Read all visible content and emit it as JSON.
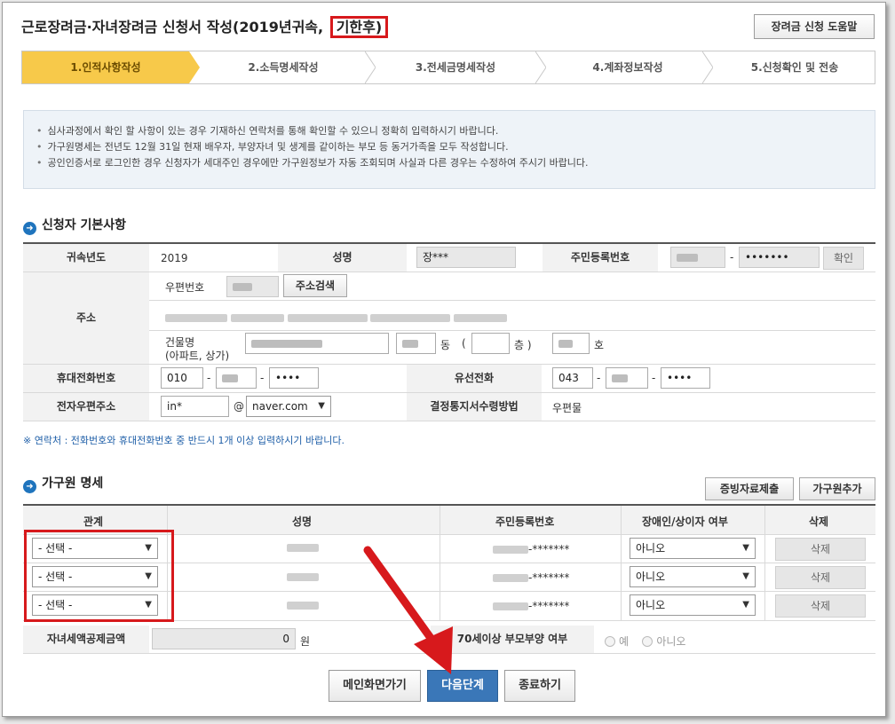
{
  "page": {
    "title_main": "근로장려금·자녀장려금 신청서 작성(2019년귀속,",
    "title_highlight": "기한후)",
    "help_label": "장려금 신청 도움말"
  },
  "steps": [
    {
      "label": "1.인적사항작성",
      "active": true
    },
    {
      "label": "2.소득명세작성",
      "active": false
    },
    {
      "label": "3.전세금명세작성",
      "active": false
    },
    {
      "label": "4.계좌정보작성",
      "active": false
    },
    {
      "label": "5.신청확인 및 전송",
      "active": false
    }
  ],
  "notice": [
    "심사과정에서 확인 할 사항이 있는 경우 기재하신 연락처를 통해 확인할 수 있으니 정확히 입력하시기 바랍니다.",
    "가구원명세는 전년도 12월 31일 현재 배우자, 부양자녀 및 생계를 같이하는 부모 등 동거가족을 모두 작성합니다.",
    "공인인증서로 로그인한 경우 신청자가 세대주인 경우에만 가구원정보가 자동 조회되며 사실과 다른 경우는 수정하여 주시기 바랍니다."
  ],
  "applicant": {
    "section_title": "신청자 기본사항",
    "year_label": "귀속년도",
    "year_value": "2019",
    "name_label": "성명",
    "name_value": "장***",
    "rrn_label": "주민등록번호",
    "rrn_back": "•••••••",
    "confirm_label": "확인",
    "address_label": "주소",
    "postcode_label": "우편번호",
    "address_search_label": "주소검색",
    "building_label": "건물명",
    "building_sub": "(아파트, 상가)",
    "dong_label": "동",
    "floor_open": "(",
    "floor_label": "층 )",
    "ho_label": "호",
    "mobile_label": "휴대전화번호",
    "mobile_1": "010",
    "mobile_3": "••••",
    "landline_label": "유선전화",
    "landline_1": "043",
    "landline_3": "••••",
    "dash": "-",
    "email_label": "전자우편주소",
    "email_id": "in*",
    "email_at": "@",
    "email_domain": "naver.com",
    "notify_label": "결정통지서수령방법",
    "notify_value": "우편물",
    "contact_note": "※ 연락처 : 전화번호와 휴대전화번호 중 반드시 1개 이상 입력하시기 바랍니다."
  },
  "household": {
    "section_title": "가구원 명세",
    "evidence_btn": "증빙자료제출",
    "add_btn": "가구원추가",
    "headers": {
      "relation": "관계",
      "name": "성명",
      "rrn": "주민등록번호",
      "disabled": "장애인/상이자 여부",
      "delete": "삭제"
    },
    "rows": [
      {
        "relation": "- 선택 -",
        "rrn_back": "-*******",
        "disabled": "아니오",
        "delete": "삭제"
      },
      {
        "relation": "- 선택 -",
        "rrn_back": "-*******",
        "disabled": "아니오",
        "delete": "삭제"
      },
      {
        "relation": "- 선택 -",
        "rrn_back": "-*******",
        "disabled": "아니오",
        "delete": "삭제"
      }
    ],
    "child_tax_label": "자녀세액공제금액",
    "child_tax_value": "0",
    "child_tax_unit": "원",
    "parent_label": "70세이상 부모부양 여부",
    "yes_label": "예",
    "no_label": "아니오"
  },
  "footer": {
    "main_btn": "메인화면가기",
    "next_btn": "다음단계",
    "exit_btn": "종료하기"
  },
  "colors": {
    "accent": "#f7c94a",
    "annotation": "#d7191c",
    "primary": "#3a77b8"
  }
}
